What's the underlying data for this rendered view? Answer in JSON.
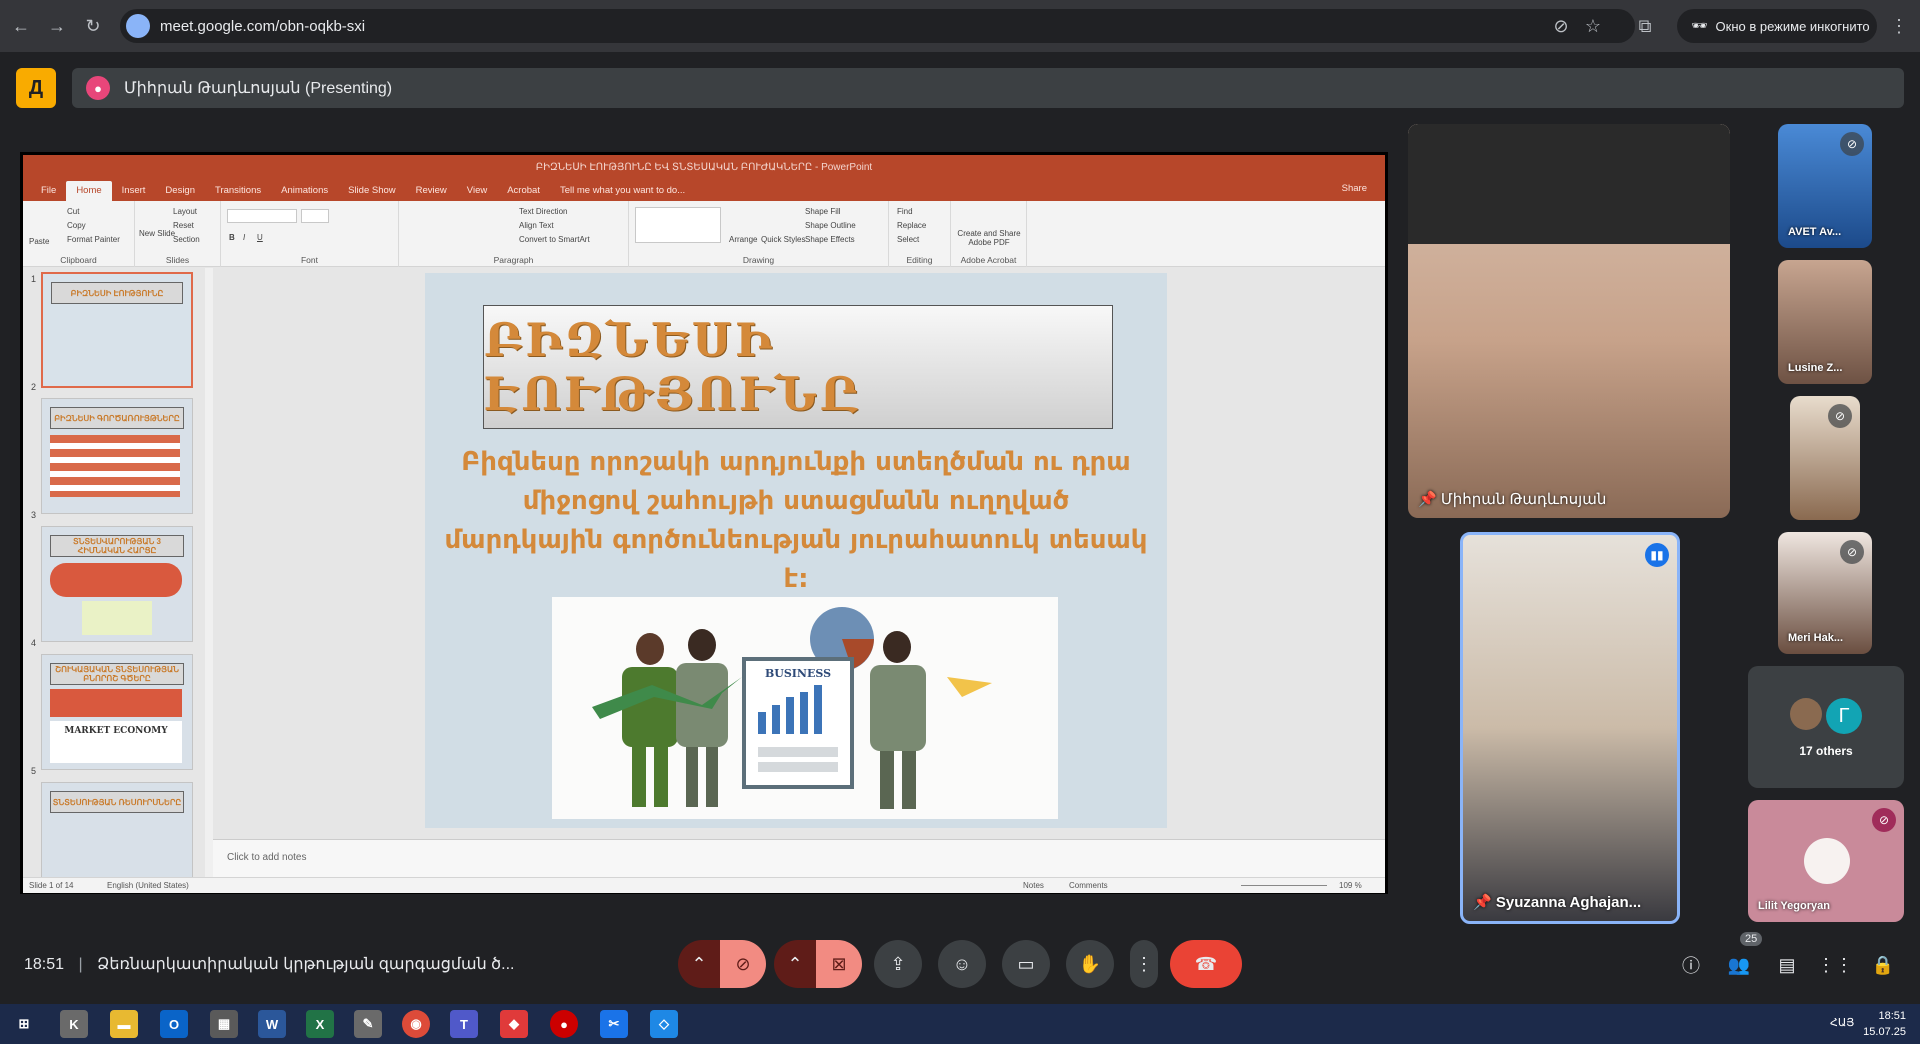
{
  "browser": {
    "url": "meet.google.com/obn-oqkb-sxi",
    "incognito_label": "Окно в режиме инкогнито"
  },
  "meet": {
    "presenter_label": "Միհրան Թադևոսյան (Presenting)",
    "time": "18:51",
    "meeting_title": "Ձեռնարկատիրական կրթության զարգացման ծ...",
    "participants_count": "25"
  },
  "powerpoint": {
    "window_title": "ԲԻԶՆԵՍԻ ԷՈՒԹՅՈՒՆԸ ԵՎ ՏՆՏԵՍԱԿԱՆ ԲՈՒԺԱԿՆԵՐԸ - PowerPoint",
    "tabs": [
      "File",
      "Home",
      "Insert",
      "Design",
      "Transitions",
      "Animations",
      "Slide Show",
      "Review",
      "View",
      "Acrobat",
      "Tell me what you want to do..."
    ],
    "share_label": "Share",
    "ribbon_groups": [
      "Clipboard",
      "Slides",
      "Font",
      "Paragraph",
      "Drawing",
      "Editing",
      "Adobe Acrobat"
    ],
    "ribbon_items": {
      "paste": "Paste",
      "cut": "Cut",
      "copy": "Copy",
      "format_painter": "Format Painter",
      "new_slide": "New Slide",
      "layout": "Layout",
      "reset": "Reset",
      "section": "Section",
      "text_direction": "Text Direction",
      "align_text": "Align Text",
      "convert_smartart": "Convert to SmartArt",
      "arrange": "Arrange",
      "quick_styles": "Quick Styles",
      "shape_fill": "Shape Fill",
      "shape_outline": "Shape Outline",
      "shape_effects": "Shape Effects",
      "find": "Find",
      "replace": "Replace",
      "select": "Select",
      "create_pdf": "Create and Share Adobe PDF"
    },
    "thumbnails": [
      {
        "num": "1",
        "title": "ԲԻԶՆԵՍԻ ԷՈՒԹՅՈՒՆԸ"
      },
      {
        "num": "2",
        "title": "ԲԻԶՆԵՍԻ ԳՈՐԾԱՌՈՒՅԹՆԵՐԸ"
      },
      {
        "num": "3",
        "title": "ՏՆՏԵՍՎԱՐՈՒԹՅԱՆ 3 ՀԻՄՆԱԿԱՆ ՀԱՐՑԸ"
      },
      {
        "num": "4",
        "title": "ՇՈՒԿԱՅԱԿԱՆ ՏՆՏԵՍՈՒԹՅԱՆ ԲՆՈՐՈՇ ԳԾԵՐԸ"
      },
      {
        "num": "5",
        "title": "ՏՆՏԵՍՈՒԹՅԱՆ ՌԵՍՈՒՐՍՆԵՐԸ"
      }
    ],
    "thumb4_caption": "MARKET ECONOMY",
    "slide": {
      "title": "ԲԻԶՆԵՍԻ ԷՈՒԹՅՈՒՆԸ",
      "body": "Բիզնեսը որոշակի արդյունքի ստեղծման ու դրա միջոցով շահույթի ստացմանն ուղղված մարդկային գործունեության յուրահատուկ տեսակ է:",
      "image_label": "BUSINESS"
    },
    "notes_placeholder": "Click to add notes",
    "status": {
      "slide_of": "Slide 1 of 14",
      "language": "English (United States)",
      "notes": "Notes",
      "comments": "Comments",
      "zoom": "109 %"
    }
  },
  "participants": [
    {
      "name": "Միհրան Թադևոսյան",
      "pinned": true
    },
    {
      "name": "Syuzanna Aghajan...",
      "pinned": true,
      "speaking": true
    },
    {
      "name": "AVET Av...",
      "muted": true
    },
    {
      "name": "Lusine Z..."
    },
    {
      "name": "",
      "muted": true
    },
    {
      "name": "Meri Hak...",
      "muted": true
    },
    {
      "name": "17 others",
      "avatar_letter": "Г"
    },
    {
      "name": "Lilit Yegoryan",
      "muted": true
    }
  ],
  "taskbar": {
    "time": "18:51",
    "date": "15.07.25",
    "lang": "ՀԱՅ"
  },
  "colors": {
    "ppt_accent": "#b7472a",
    "slide_text": "#d4893a",
    "end_call": "#ea4335",
    "meet_logo": "#f9ab00"
  }
}
